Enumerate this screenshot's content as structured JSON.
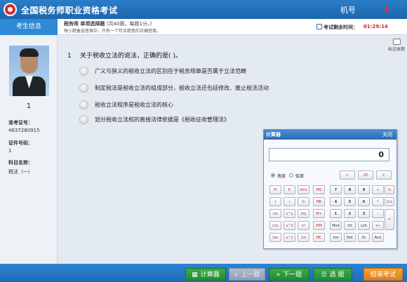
{
  "header": {
    "app_title": "全国税务师职业资格考试",
    "seat_label": "机号",
    "seat_number": "1"
  },
  "subheader": {
    "candidate_tab": "考生信息",
    "question_type": "税务师 单项选择题",
    "question_type_note": "(共40题，每题1分。)",
    "instruction": "每小题备选答案中，只有一个符合题意的正确答案。",
    "timer_label": "考试剩余时间：",
    "timer_value": "01:29:14",
    "mark_label": "标记本题"
  },
  "candidate": {
    "number": "1",
    "admission_label": "准考证号：",
    "admission_value": "4637280915",
    "id_label": "证件号码：",
    "id_value": "1",
    "subject_label": "科目名称：",
    "subject_value": "税法（一）"
  },
  "question": {
    "number": "1",
    "text": "关于税收立法的说法，正确的是(        )。",
    "options": [
      "广义与狭义的税收立法的区别在于税务规章是否属于立法范畴",
      "制定税法是税收立法的组成部分，税收立法还包括修改、废止税法活动",
      "税收立法程序是税收立法的核心",
      "划分税收立法权的直接法律依据是《税收征收管理法》"
    ]
  },
  "calculator": {
    "title": "计算器",
    "close_label": "关闭",
    "display": "0",
    "mode_degree": "角度",
    "mode_radian": "弧度",
    "keys": {
      "backspace": "←",
      "ce": "CE",
      "c": "C",
      "pi": "PI",
      "e": "E",
      "dms": "dms",
      "ms": "MS",
      "n7": "7",
      "n8": "8",
      "n9": "9",
      "divide": "÷",
      "percent": "%",
      "lparen": "(",
      "rparen": ")",
      "ln": "ln",
      "mr": "MR",
      "n4": "4",
      "n5": "5",
      "n6": "6",
      "multiply": "*",
      "reciprocal": "1/x",
      "sin": "sin",
      "xpowy": "x^y",
      "log": "log",
      "mplus": "M+",
      "n1": "1",
      "n2": "2",
      "n3": "3",
      "minus": "-",
      "equals": "=",
      "cos": "cos",
      "x3": "x^3",
      "fact": "n!",
      "mm": "MM",
      "mod": "Mod",
      "int": "Int",
      "lsh": "Lsh",
      "plusminus": "+/-",
      "tan": "tan",
      "x2": "x^2",
      "inverse": "1/x",
      "mc": "MC",
      "xor": "Xor",
      "not": "Not",
      "or": "Or",
      "and": "And",
      "plus": "+",
      "sqrt": "√",
      "dot": "."
    }
  },
  "footer": {
    "calculator_button": "计算器",
    "prev_button": "上一题",
    "next_button": "下一题",
    "select_button": "选 题",
    "finish_button": "结束考试"
  }
}
